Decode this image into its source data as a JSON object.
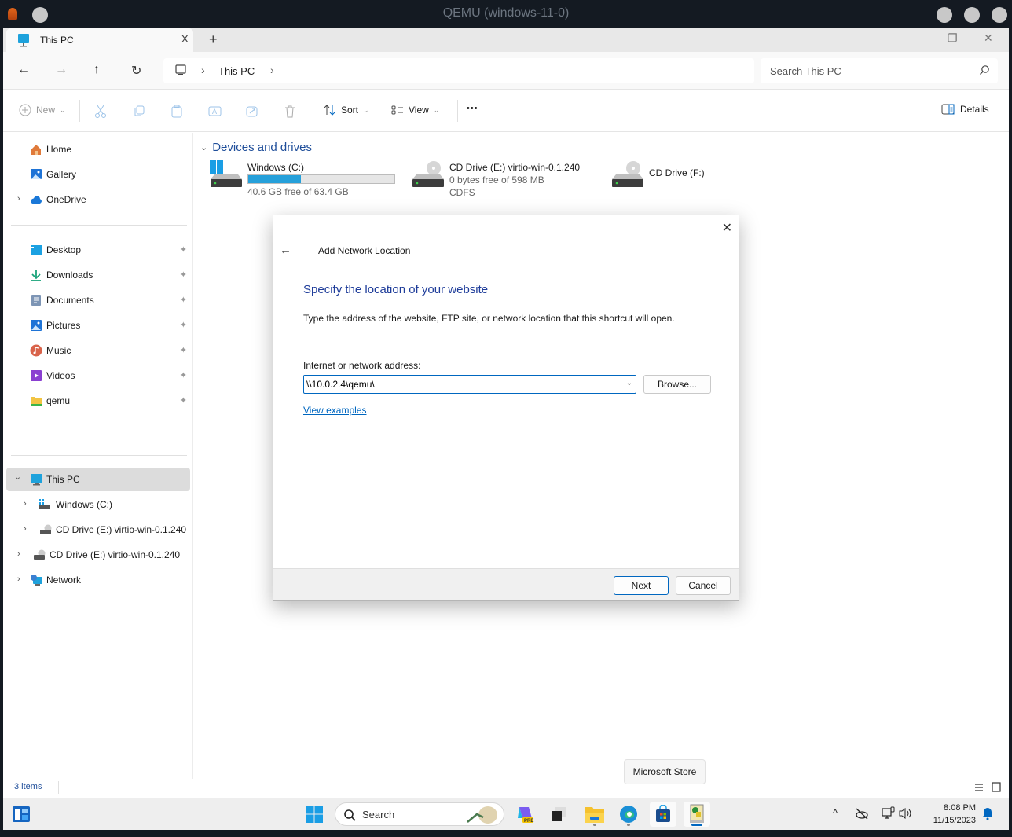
{
  "qemu": {
    "title": "QEMU (windows-11-0)"
  },
  "explorer": {
    "tab": {
      "label": "This PC",
      "close_glyph": "X"
    },
    "new_tab_glyph": "+",
    "window_controls": {
      "minimize": "—",
      "maximize": "❐",
      "close": "✕"
    },
    "nav": {
      "back": "←",
      "forward": "→",
      "up": "↑",
      "refresh": "↻"
    },
    "breadcrumb": {
      "items": [
        "This PC"
      ],
      "separator": "›"
    },
    "search": {
      "placeholder": "Search This PC"
    },
    "commands": {
      "new": "New",
      "sort": "Sort",
      "view": "View",
      "more": "•••",
      "details": "Details"
    },
    "sidebar": {
      "quick": [
        {
          "label": "Home",
          "icon": "home-icon"
        },
        {
          "label": "Gallery",
          "icon": "gallery-icon"
        },
        {
          "label": "OneDrive",
          "icon": "onedrive-icon",
          "expandable": true
        }
      ],
      "pinned": [
        {
          "label": "Desktop",
          "icon": "desktop-icon"
        },
        {
          "label": "Downloads",
          "icon": "downloads-icon"
        },
        {
          "label": "Documents",
          "icon": "documents-icon"
        },
        {
          "label": "Pictures",
          "icon": "pictures-icon"
        },
        {
          "label": "Music",
          "icon": "music-icon"
        },
        {
          "label": "Videos",
          "icon": "videos-icon"
        },
        {
          "label": "qemu",
          "icon": "folder-icon"
        }
      ],
      "tree": [
        {
          "label": "This PC",
          "icon": "this-pc-icon",
          "expanded": true,
          "selected": true
        },
        {
          "label": "Windows (C:)",
          "icon": "drive-icon",
          "indent": 1
        },
        {
          "label": "CD Drive (E:) virtio-win-0.1.240",
          "icon": "cd-drive-icon",
          "indent": 1
        },
        {
          "label": "CD Drive (E:) virtio-win-0.1.240",
          "icon": "cd-drive-icon",
          "indent": 0
        },
        {
          "label": "Network",
          "icon": "network-icon",
          "indent": 0
        }
      ],
      "pin_glyph": "📌",
      "chev_right": "›",
      "chev_down": "⌄"
    },
    "main": {
      "section": "Devices and drives",
      "drives": [
        {
          "name": "Windows (C:)",
          "free": "40.6 GB free of 63.4 GB",
          "used_percent": 36
        },
        {
          "name": "CD Drive (E:) virtio-win-0.1.240",
          "free": "0 bytes free of 598 MB",
          "fs": "CDFS"
        },
        {
          "name": "CD Drive (F:)"
        }
      ]
    },
    "status": {
      "items_count": "3 items"
    }
  },
  "dialog": {
    "close_glyph": "✕",
    "back_glyph": "←",
    "title": "Add Network Location",
    "heading": "Specify the location of your website",
    "description": "Type the address of the website, FTP site, or network location that this shortcut will open.",
    "field_label": "Internet or network address:",
    "field_value": "\\\\10.0.2.4\\qemu\\",
    "browse": "Browse...",
    "view_examples": "View examples",
    "next": "Next",
    "cancel": "Cancel"
  },
  "taskbar": {
    "search_placeholder": "Search",
    "tooltip": "Microsoft Store",
    "time": "8:08 PM",
    "date": "11/15/2023",
    "tray_chevron": "^"
  },
  "colors": {
    "accent": "#0067c0",
    "heading_blue": "#1f3d9a",
    "progress": "#26a0da"
  }
}
